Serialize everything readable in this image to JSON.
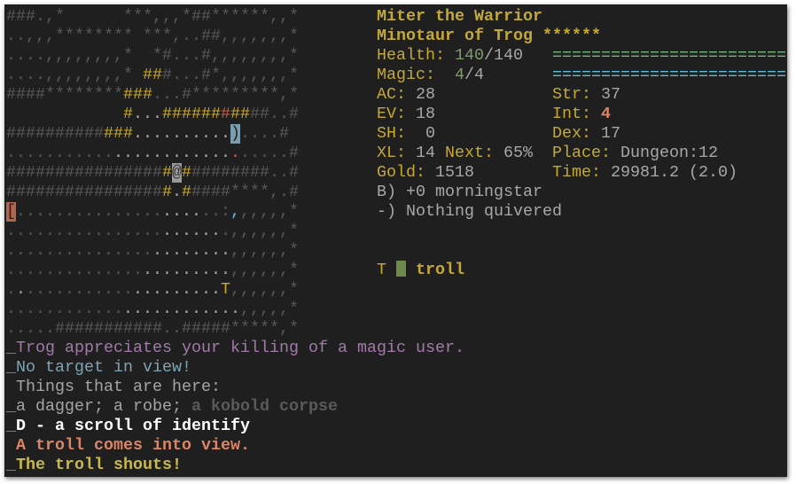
{
  "map": {
    "rows": [
      "###.,*      ***,,,*##******,,*",
      "..,,,******** ***,..##,,,,,,,*",
      "....,,,,,,,,*  *#...#,,,,,,,,*",
      "....,,,,,,,,* ###...#*,,,,,,,*",
      "####********###...#*********,*",
      "            #...###########..#",
      "#############..........)....#",
      ".............................#",
      "#################@#########..#",
      "#################.#####****,.#",
      "[.....................:,,,,,,*",
      ".......................,,,,,,*",
      ".......................,,,,,,*",
      ".......................,,,,,,*",
      "......................T,,,,,,*",
      "........................,,,,,*",
      ".....###########..#####*****,*"
    ],
    "colors": [
      "",
      "",
      "",
      "ggggggggggggggyy",
      "ggggggggggggyyy",
      "ggggggggggggylllyyyyyyryy",
      "ggggggggggyyyllllllllllB",
      "gggggggggggllllllllllllr",
      "ggggggggggggggggyGy",
      "ggggggggggggggggyly",
      "Rgggggggggggggggllllgggc",
      "ggggggggggggggggllllll",
      "gggggggggggggggllllllll",
      "gggggggggggggglllllllll",
      "glgggggggggggllllllllly",
      "ggggggggggggllllllllllll",
      ""
    ],
    "palette": {
      "g": "#585858",
      "l": "#a9a9a9",
      "y": "#c9a92a",
      "r": "#c0604a",
      "c": "#5fc0d8",
      "B": "#7b9eae",
      "G": "#9a9a9a",
      "R": "#b3654f"
    }
  },
  "stats": {
    "name": "Miter the Warrior",
    "title": "Minotaur of Trog ******",
    "health_label": "Health: ",
    "health_cur": "140",
    "health_max": "/140",
    "health_fraction": 1.0,
    "health_bar": "==============================",
    "magic_label": "Magic:  ",
    "magic_cur": "4",
    "magic_max": "/4",
    "magic_fraction": 1.0,
    "magic_bar": "==============================",
    "ac_label": "AC: ",
    "ac": "28",
    "ev_label": "EV: ",
    "ev": "18",
    "sh_label": "SH:  ",
    "sh": "0",
    "xl_label": "XL: ",
    "xl": "14",
    "next_label": " Next: ",
    "next": "65%",
    "gold_label": "Gold: ",
    "gold": "1518",
    "str_label": "Str: ",
    "str": "37",
    "int_label": "Int: ",
    "int": "4",
    "dex_label": "Dex: ",
    "dex": "17",
    "place_label": "Place: ",
    "place": "Dungeon:12",
    "time_label": "Time: ",
    "time": "29981.2 (2.0)",
    "weapon": "B) +0 morningstar",
    "quiver": "-) Nothing quivered"
  },
  "monsters": [
    {
      "glyph": "T",
      "name": "troll",
      "health_color": "#6d8a4a"
    }
  ],
  "messages": [
    {
      "prefix": "_",
      "text": "Trog appreciates your killing of a magic user."
    },
    {
      "prefix": "_",
      "text": "No target in view!"
    },
    {
      "prefix": " ",
      "text": "Things that are here:"
    },
    {
      "prefix": "_",
      "text": "a dagger; a robe; ",
      "text2": "a kobold corpse"
    },
    {
      "prefix": "_",
      "text": "D - a scroll of identify"
    },
    {
      "prefix": " ",
      "text": "A troll comes into view."
    },
    {
      "prefix": "_",
      "text": "The troll shouts!"
    }
  ]
}
